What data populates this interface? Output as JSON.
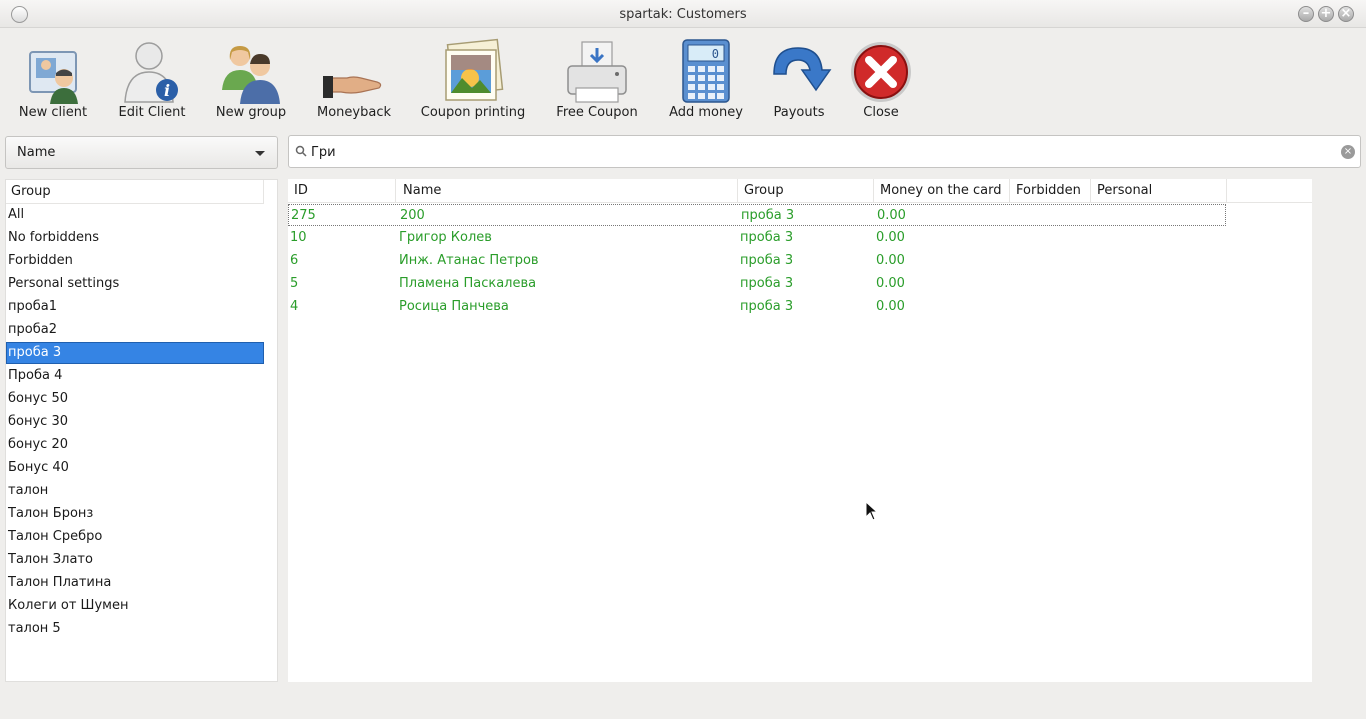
{
  "window": {
    "title": "spartak: Customers"
  },
  "toolbar": {
    "buttons": [
      {
        "label": "New client",
        "icon": "new-client-icon"
      },
      {
        "label": "Edit Client",
        "icon": "edit-client-icon"
      },
      {
        "label": "New group",
        "icon": "new-group-icon"
      },
      {
        "label": "Moneyback",
        "icon": "moneyback-icon"
      },
      {
        "label": "Coupon printing",
        "icon": "coupon-printing-icon"
      },
      {
        "label": "Free Coupon",
        "icon": "free-coupon-icon"
      },
      {
        "label": "Add money",
        "icon": "add-money-icon"
      },
      {
        "label": "Payouts",
        "icon": "payouts-icon"
      },
      {
        "label": "Close",
        "icon": "close-icon"
      }
    ]
  },
  "filter": {
    "field_selected": "Name",
    "search_value": "Гри"
  },
  "groups": {
    "header": "Group",
    "items": [
      "All",
      "No forbiddens",
      "Forbidden",
      "Personal settings",
      "проба1",
      "проба2",
      "проба 3",
      "Проба 4",
      "бонус 50",
      "бонус 30",
      "бонус 20",
      "Бонус 40",
      "талон",
      "Талон Бронз",
      "Талон Сребро",
      "Талон Злато",
      "Талон Платина",
      "Колеги от Шумен",
      "талон 5"
    ],
    "selected": "проба 3"
  },
  "customers": {
    "columns": [
      "ID",
      "Name",
      "Group",
      "Money on the card",
      "Forbidden",
      "Personal"
    ],
    "rows": [
      [
        "275",
        "200",
        "проба 3",
        "0.00",
        "",
        ""
      ],
      [
        "10",
        "Григор Колев",
        "проба 3",
        "0.00",
        "",
        ""
      ],
      [
        "6",
        "Инж. Атанас Петров",
        "проба 3",
        "0.00",
        "",
        ""
      ],
      [
        "5",
        "Пламена Паскалева",
        "проба 3",
        "0.00",
        "",
        ""
      ],
      [
        "4",
        "Росица Панчева",
        "проба 3",
        "0.00",
        "",
        ""
      ]
    ],
    "row_text_color": "#2a9d2a"
  },
  "colors": {
    "selection": "#3584e4",
    "window_bg": "#efeeec"
  }
}
